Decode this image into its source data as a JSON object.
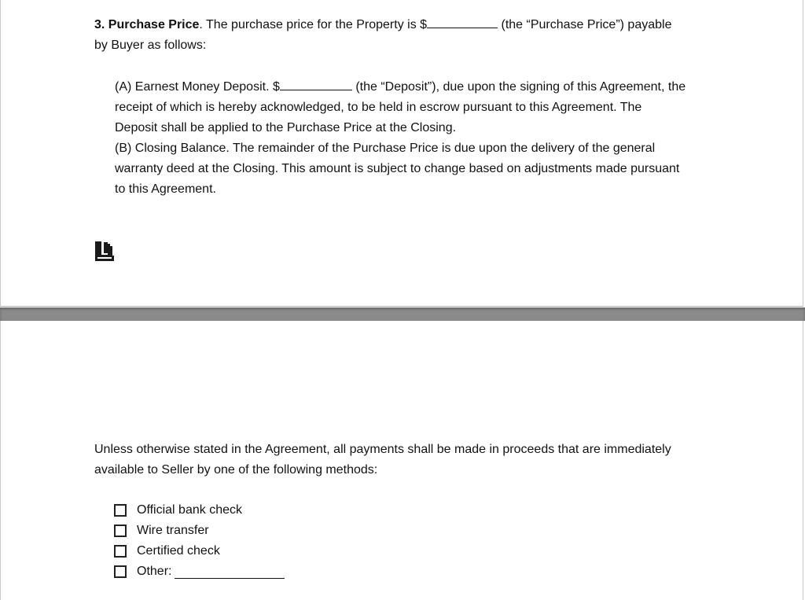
{
  "section3": {
    "number": "3.",
    "title": "Purchase Price",
    "intro_a": ". The purchase price for the Property is $",
    "intro_b": " (the “Purchase Price”) payable",
    "intro_c": "by Buyer as follows:"
  },
  "subsections": {
    "a_line1_a": "(A) Earnest Money Deposit. $",
    "a_line1_b": " (the “Deposit”), due upon the signing of this Agreement, the",
    "a_line2": "receipt of which is hereby acknowledged, to be held in escrow pursuant to this Agreement. The",
    "a_line3": "Deposit shall be applied to the Purchase Price at the Closing.",
    "b_line1": "(B) Closing Balance. The remainder of the Purchase Price is due upon the delivery of the general",
    "b_line2": "warranty deed at the Closing.  This amount is subject to change based on adjustments made pursuant",
    "b_line3": "to this Agreement."
  },
  "logo": {
    "icon": "document-logo-icon"
  },
  "payment": {
    "line1": "Unless otherwise stated in the Agreement, all payments shall be made in proceeds that are immediately",
    "line2": "available to Seller by one of the following methods:",
    "options": [
      {
        "label": "Official bank check"
      },
      {
        "label": "Wire transfer"
      },
      {
        "label": "Certified check"
      },
      {
        "label": "Other:"
      }
    ]
  }
}
